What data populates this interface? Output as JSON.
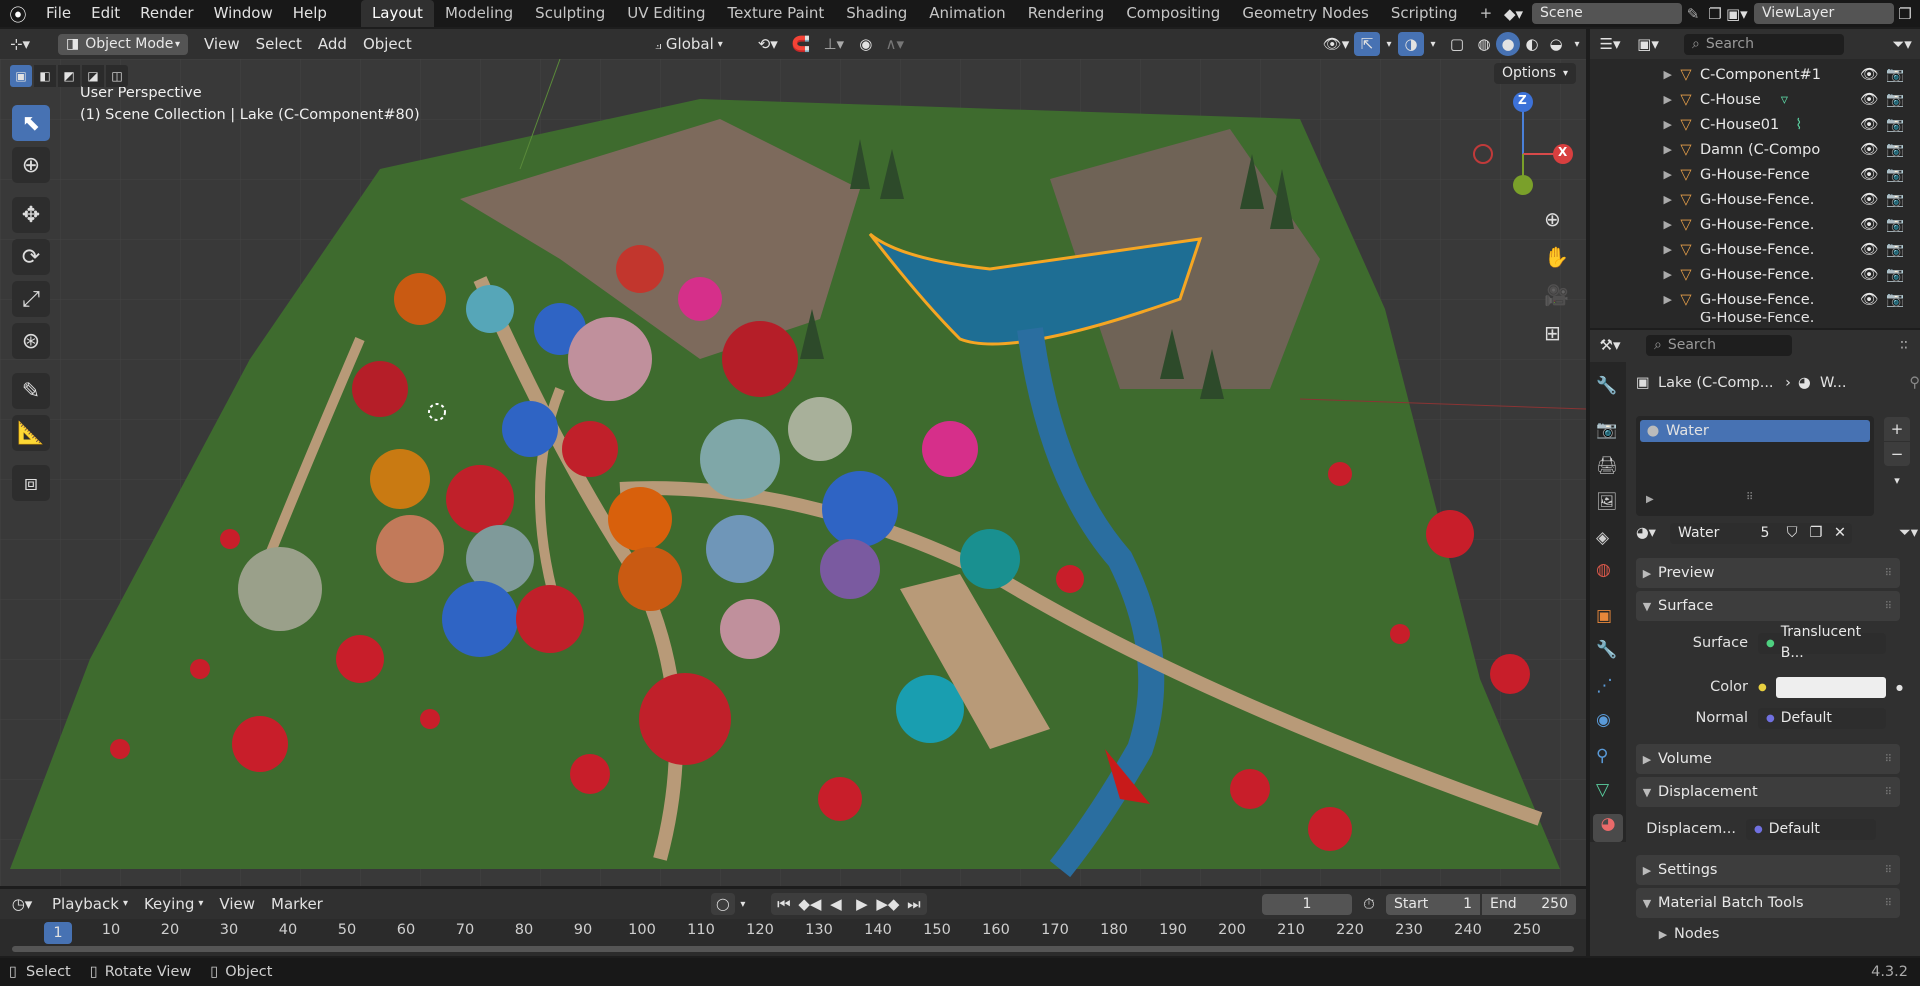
{
  "topbar": {
    "menus": [
      "File",
      "Edit",
      "Render",
      "Window",
      "Help"
    ],
    "workspaces": [
      "Layout",
      "Modeling",
      "Sculpting",
      "UV Editing",
      "Texture Paint",
      "Shading",
      "Animation",
      "Rendering",
      "Compositing",
      "Geometry Nodes",
      "Scripting"
    ],
    "add_tab": "+",
    "scene": "Scene",
    "view_layer": "ViewLayer"
  },
  "viewport_header": {
    "mode": "Object Mode",
    "menus": [
      "View",
      "Select",
      "Add",
      "Object"
    ],
    "orientation": "Global",
    "options": "Options"
  },
  "viewport": {
    "perspective": "User Perspective",
    "collection": "(1) Scene Collection | Lake (C-Component#80)",
    "gizmo": {
      "z": "Z",
      "x": "X"
    }
  },
  "outliner": {
    "search_placeholder": "Search",
    "rows": [
      "C-Component#1",
      "C-House",
      "C-House01",
      "Damn (C-Compo",
      "G-House-Fence",
      "G-House-Fence.",
      "G-House-Fence.",
      "G-House-Fence.",
      "G-House-Fence.",
      "G-House-Fence.",
      "G-House-Fence."
    ]
  },
  "properties": {
    "search_placeholder": "Search",
    "breadcrumb_object": "Lake (C-Comp...",
    "breadcrumb_material": "W...",
    "slot": "Water",
    "material_name": "Water",
    "user_count": "5",
    "panels": {
      "preview": "Preview",
      "surface": "Surface",
      "volume": "Volume",
      "displacement": "Displacement",
      "settings": "Settings",
      "batch": "Material Batch Tools",
      "nodes": "Nodes"
    },
    "surface_label": "Surface",
    "surface_value": "Translucent B...",
    "color_label": "Color",
    "normal_label": "Normal",
    "normal_value": "Default",
    "displacement_label": "Displacem...",
    "displacement_value": "Default"
  },
  "timeline": {
    "menus": [
      "Playback",
      "Keying",
      "View",
      "Marker"
    ],
    "current_frame": "1",
    "start_label": "Start",
    "start": "1",
    "end_label": "End",
    "end": "250",
    "ticks": [
      "1",
      "10",
      "20",
      "30",
      "40",
      "50",
      "60",
      "70",
      "80",
      "90",
      "100",
      "110",
      "120",
      "130",
      "140",
      "150",
      "160",
      "170",
      "180",
      "190",
      "200",
      "210",
      "220",
      "230",
      "240",
      "250"
    ]
  },
  "statusbar": {
    "select": "Select",
    "rotate": "Rotate View",
    "object": "Object",
    "version": "4.3.2"
  },
  "colors": {
    "accent": "#4772b3",
    "selection_outline": "#f5a623",
    "material_icon": "#e96a6a"
  }
}
